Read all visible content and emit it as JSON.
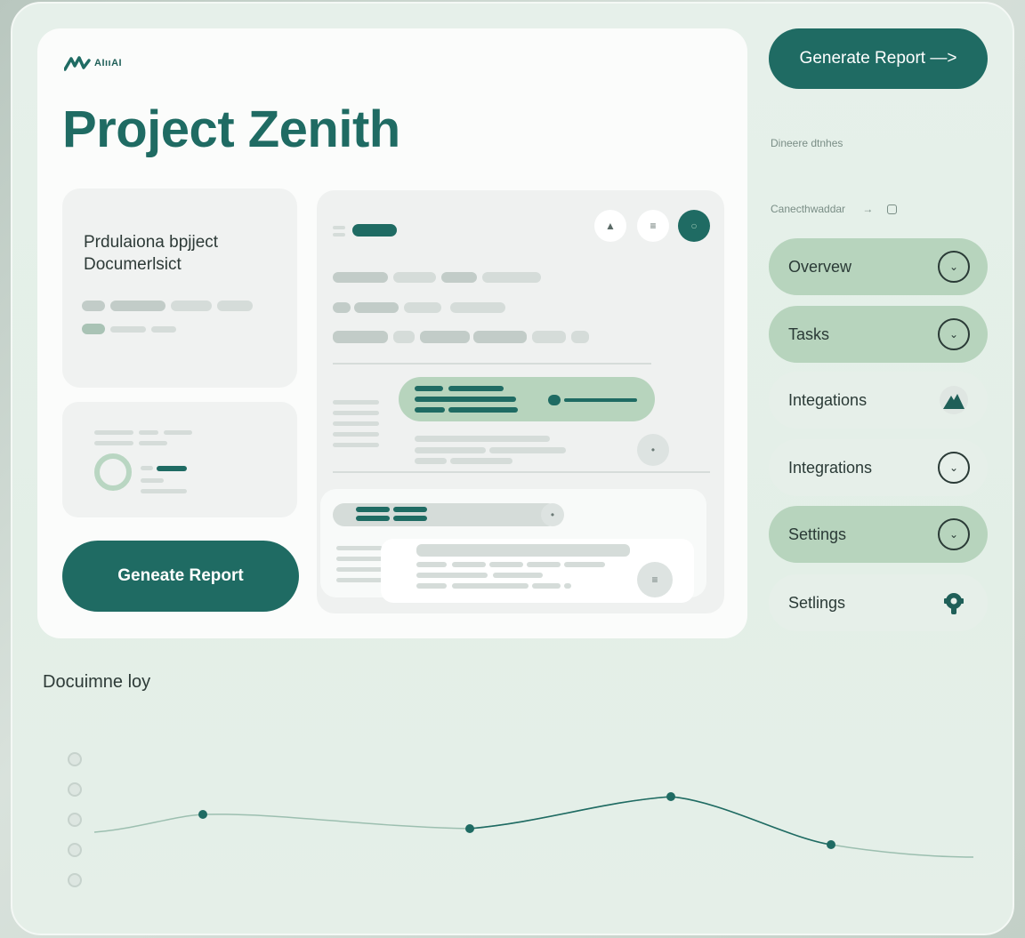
{
  "logo": {
    "text": "AIııAI"
  },
  "page": {
    "title": "Project Zenith"
  },
  "doc_card": {
    "title": "Prdulaiona bpjject Documerlsict"
  },
  "main_button": {
    "label": "Geneate Report"
  },
  "top_button": {
    "label": "Generate Report —>"
  },
  "sidebar": {
    "label_1": "Dineere dtnhes",
    "label_2": "Canecthwaddar",
    "label_2_arrow": "→",
    "items": [
      {
        "label": "Overvew",
        "icon": "chevron-down-icon",
        "active": true
      },
      {
        "label": "Tasks",
        "icon": "chevron-down-icon",
        "active": true
      },
      {
        "label": "Integations",
        "icon": "mountain-icon",
        "active": false
      },
      {
        "label": "Integrations",
        "icon": "chevron-down-icon",
        "active": false
      },
      {
        "label": "Settings",
        "icon": "chevron-down-icon",
        "active": true
      },
      {
        "label": "Setlings",
        "icon": "gear-icon",
        "active": false
      }
    ]
  },
  "bottom": {
    "title": "Docuimne loy"
  },
  "trend_chart": {
    "points": [
      0.62,
      0.35,
      0.32,
      0.18,
      0.12,
      0.08,
      0.38,
      0.36,
      0.62,
      0.6
    ]
  },
  "colors": {
    "accent": "#1f6b63",
    "accent_light": "#b7d4bd",
    "background": "#e4efe8"
  }
}
